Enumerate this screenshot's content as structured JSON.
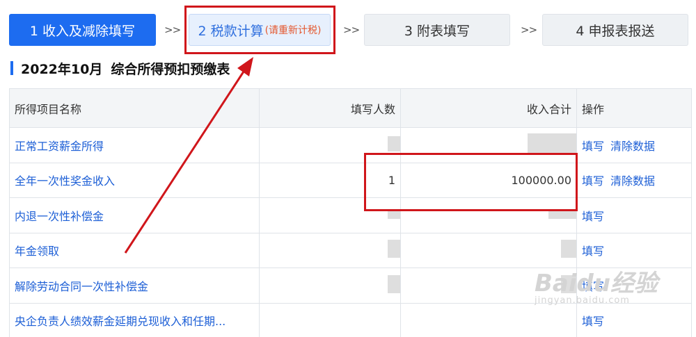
{
  "steps": [
    {
      "label": "1 收入及减除填写",
      "sub": ""
    },
    {
      "label": "2 税款计算",
      "sub": "(请重新计税)"
    },
    {
      "label": "3 附表填写",
      "sub": ""
    },
    {
      "label": "4 申报表报送",
      "sub": ""
    }
  ],
  "step_separator": ">>",
  "title": {
    "period": "2022年10月",
    "name": "综合所得预扣预缴表"
  },
  "table": {
    "headers": {
      "name": "所得项目名称",
      "count": "填写人数",
      "income": "收入合计",
      "action": "操作"
    },
    "rows": [
      {
        "name": "正常工资薪金所得",
        "count": "",
        "income": "",
        "actions": [
          "填写",
          "清除数据"
        ]
      },
      {
        "name": "全年一次性奖金收入",
        "count": "1",
        "income": "100000.00",
        "actions": [
          "填写",
          "清除数据"
        ]
      },
      {
        "name": "内退一次性补偿金",
        "count": "",
        "income": "",
        "actions": [
          "填写"
        ]
      },
      {
        "name": "年金领取",
        "count": "",
        "income": "",
        "actions": [
          "填写"
        ]
      },
      {
        "name": "解除劳动合同一次性补偿金",
        "count": "",
        "income": "",
        "actions": [
          "填写"
        ]
      },
      {
        "name": "央企负责人绩效薪金延期兑现收入和任期...",
        "count": "",
        "income": "",
        "actions": [
          "填写"
        ]
      }
    ]
  },
  "watermark": {
    "logo": "Baidu经验",
    "url": "jingyan.baidu.com"
  },
  "colors": {
    "accent": "#1d6cf0",
    "highlight": "#d0161b",
    "link": "#1d5fd6"
  }
}
